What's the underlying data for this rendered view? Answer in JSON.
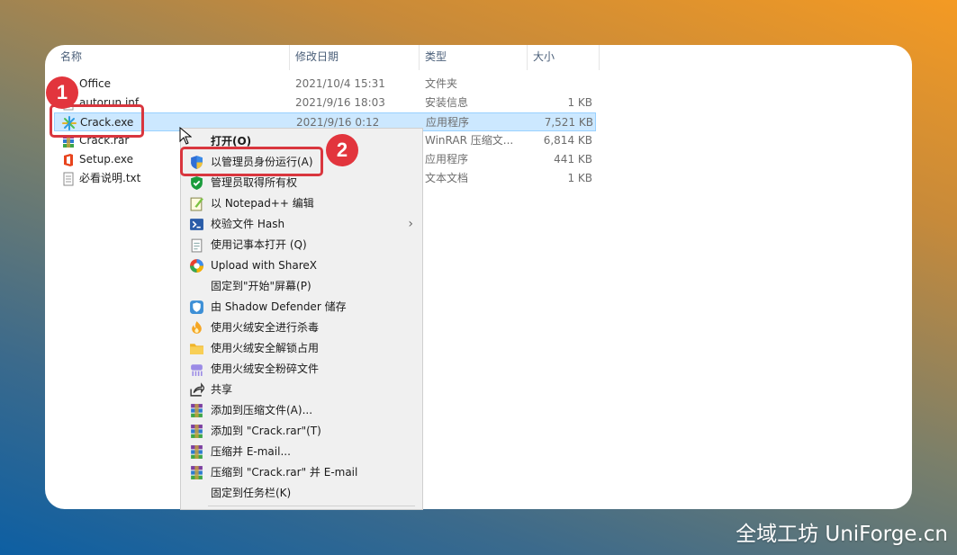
{
  "columns": {
    "name": "名称",
    "date": "修改日期",
    "type": "类型",
    "size": "大小"
  },
  "files": [
    {
      "icon": "folder-icon",
      "name": "Office",
      "date": "2021/10/4 15:31",
      "type": "文件夹",
      "size": ""
    },
    {
      "icon": "settings-file-icon",
      "name": "autorun.inf",
      "date": "2021/9/16 18:03",
      "type": "安装信息",
      "size": "1 KB"
    },
    {
      "icon": "crack-exe-icon",
      "name": "Crack.exe",
      "date": "2021/9/16 0:12",
      "type": "应用程序",
      "size": "7,521 KB",
      "selected": true
    },
    {
      "icon": "winrar-icon",
      "name": "Crack.rar",
      "date": "",
      "type": "WinRAR 压缩文...",
      "size": "6,814 KB"
    },
    {
      "icon": "office-icon",
      "name": "Setup.exe",
      "date": "",
      "type": "应用程序",
      "size": "441 KB"
    },
    {
      "icon": "text-file-icon",
      "name": "必看说明.txt",
      "date": "",
      "type": "文本文档",
      "size": "1 KB"
    }
  ],
  "menu": [
    {
      "label": "打开(O)",
      "bold": true,
      "icon": ""
    },
    {
      "label": "以管理员身份运行(A)",
      "icon": "uac-shield-icon"
    },
    {
      "label": "管理员取得所有权",
      "icon": "green-shield-check-icon"
    },
    {
      "label": "以 Notepad++ 编辑",
      "icon": "notepadpp-icon"
    },
    {
      "label": "校验文件 Hash",
      "icon": "powershell-icon",
      "submenu": true
    },
    {
      "label": "使用记事本打开 (Q)",
      "icon": "notepad-icon"
    },
    {
      "label": "Upload with ShareX",
      "icon": "sharex-icon"
    },
    {
      "label": "固定到\"开始\"屏幕(P)",
      "icon": ""
    },
    {
      "label": "由 Shadow Defender 储存",
      "icon": "shadow-defender-icon"
    },
    {
      "label": "使用火绒安全进行杀毒",
      "icon": "huorong-flame-icon"
    },
    {
      "label": "使用火绒安全解锁占用",
      "icon": "folder-unlock-icon"
    },
    {
      "label": "使用火绒安全粉碎文件",
      "icon": "shredder-icon"
    },
    {
      "label": "共享",
      "icon": "share-icon"
    },
    {
      "label": "添加到压缩文件(A)...",
      "icon": "winrar-icon"
    },
    {
      "label": "添加到 \"Crack.rar\"(T)",
      "icon": "winrar-icon"
    },
    {
      "label": "压缩并 E-mail...",
      "icon": "winrar-icon"
    },
    {
      "label": "压缩到 \"Crack.rar\" 并 E-mail",
      "icon": "winrar-icon"
    },
    {
      "label": "固定到任务栏(K)",
      "icon": ""
    }
  ],
  "badges": {
    "one": "1",
    "two": "2"
  },
  "watermark": "全域工坊 UniForge.cn",
  "colors": {
    "highlight": "#d9363e",
    "selection": "#cce8ff"
  }
}
